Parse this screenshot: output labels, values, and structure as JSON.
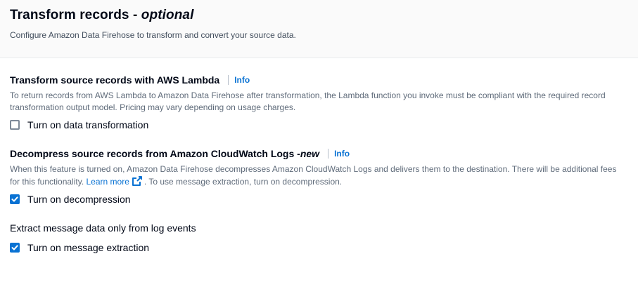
{
  "header": {
    "title": "Transform records - ",
    "title_optional": "optional",
    "subtitle": "Configure Amazon Data Firehose to transform and convert your source data."
  },
  "lambda_section": {
    "heading": "Transform source records with AWS Lambda",
    "info_label": "Info",
    "description": "To return records from AWS Lambda to Amazon Data Firehose after transformation, the Lambda function you invoke must be compliant with the required record transformation output model. Pricing may vary depending on usage charges.",
    "checkbox_label": "Turn on data transformation",
    "checked": false
  },
  "decompress_section": {
    "heading": "Decompress source records from Amazon CloudWatch Logs - ",
    "heading_new": "new",
    "info_label": "Info",
    "description_before_link": "When this feature is turned on, Amazon Data Firehose decompresses Amazon CloudWatch Logs and delivers them to the destination. There will be additional fees for this functionality. ",
    "learn_more": "Learn more",
    "description_after_link": ". To use message extraction, turn on decompression.",
    "external_icon": "external-link-icon",
    "checkbox_label": "Turn on decompression",
    "checked": true
  },
  "extract_section": {
    "label": "Extract message data only from log events",
    "checkbox_label": "Turn on message extraction",
    "checked": true
  },
  "colors": {
    "accent": "#0972d3",
    "text": "#000716",
    "muted": "#5f6b7a"
  }
}
